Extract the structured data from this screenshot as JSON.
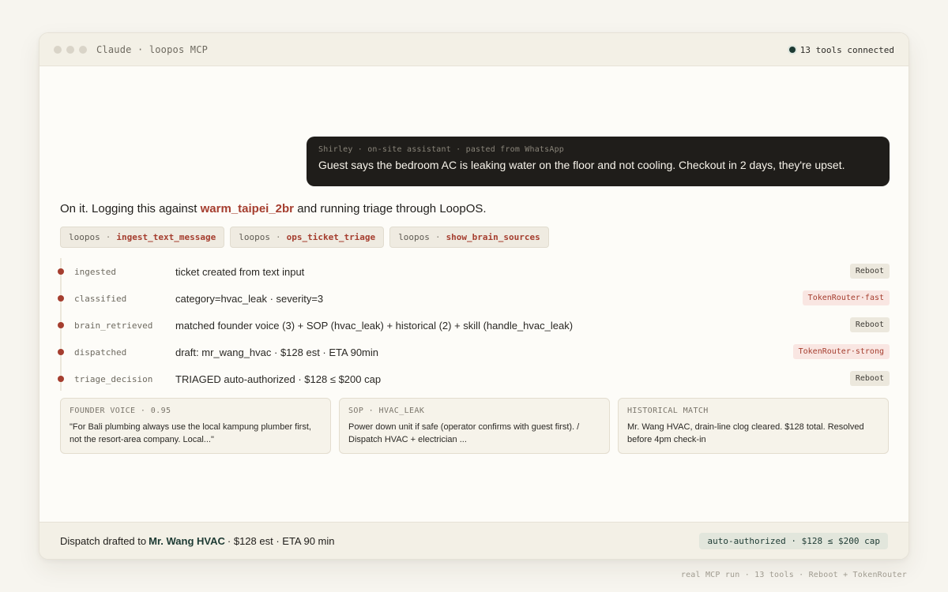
{
  "window": {
    "title": "Claude · loopos MCP",
    "tools_status": "13 tools connected"
  },
  "message": {
    "meta": "Shirley · on-site assistant · pasted from WhatsApp",
    "text": "Guest says the bedroom AC is leaking water on the floor and not cooling. Checkout in 2 days, they're upset."
  },
  "assistant": {
    "prefix": "On it. Logging this against",
    "property": "warm_taipei_2br",
    "suffix": "and running triage through LoopOS."
  },
  "tool_calls": [
    {
      "server": "loopos",
      "sep": "·",
      "tool": "ingest_text_message"
    },
    {
      "server": "loopos",
      "sep": "·",
      "tool": "ops_ticket_triage"
    },
    {
      "server": "loopos",
      "sep": "·",
      "tool": "show_brain_sources"
    }
  ],
  "steps": [
    {
      "key": "ingested",
      "desc": "ticket created from text input",
      "badge": "Reboot",
      "badge_style": "neutral"
    },
    {
      "key": "classified",
      "desc": "category=hvac_leak · severity=3",
      "badge": "TokenRouter·fast",
      "badge_style": "accent"
    },
    {
      "key": "brain_retrieved",
      "desc": "matched founder voice (3) + SOP (hvac_leak) + historical (2) + skill (handle_hvac_leak)",
      "badge": "Reboot",
      "badge_style": "neutral"
    },
    {
      "key": "dispatched",
      "desc": "draft: mr_wang_hvac · $128 est · ETA 90min",
      "badge": "TokenRouter·strong",
      "badge_style": "accent"
    },
    {
      "key": "triage_decision",
      "desc": "TRIAGED auto-authorized · $128 ≤ $200 cap",
      "badge": "Reboot",
      "badge_style": "neutral"
    }
  ],
  "sources": [
    {
      "label": "FOUNDER VOICE · 0.95",
      "text": "\"For Bali plumbing always use the local kampung plumber first, not the resort-area company. Local...\""
    },
    {
      "label": "SOP · HVAC_LEAK",
      "text": "Power down unit if safe (operator confirms with guest first). / Dispatch HVAC + electrician ..."
    },
    {
      "label": "HISTORICAL MATCH",
      "text": "Mr. Wang HVAC, drain-line clog cleared. $128 total. Resolved before 4pm check-in"
    }
  ],
  "footer": {
    "prefix": "Dispatch drafted to",
    "vendor": "Mr. Wang HVAC",
    "suffix": "· $128 est · ETA 90 min",
    "badge": "auto-authorized · $128 ≤ $200 cap"
  },
  "caption": "real MCP run · 13 tools · Reboot + TokenRouter",
  "colors": {
    "accent": "#a53e2f",
    "vendor": "#1d3a33",
    "bubble": "#1f1d1a"
  }
}
